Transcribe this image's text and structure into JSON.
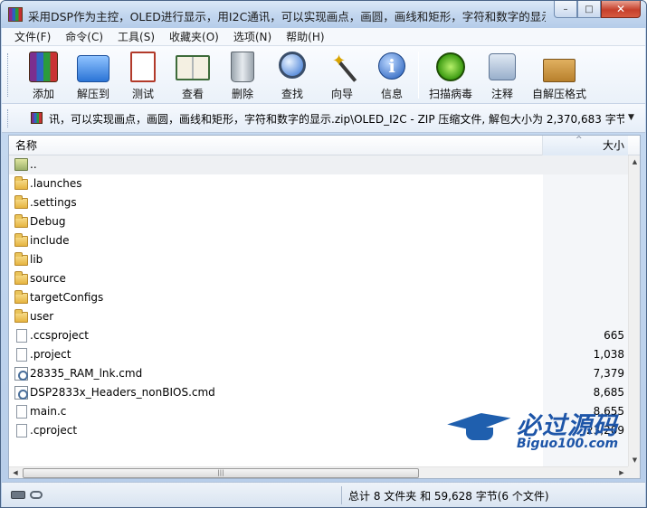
{
  "window": {
    "title": "采用DSP作为主控，OLED进行显示，用I2C通讯，可以实现画点，画圆，画线和矩形，字符和数字的显示...",
    "controls": {
      "minimize": "–",
      "maximize": "□",
      "close": "✕"
    }
  },
  "menu": [
    "文件(F)",
    "命令(C)",
    "工具(S)",
    "收藏夹(O)",
    "选项(N)",
    "帮助(H)"
  ],
  "toolbar": {
    "add": "添加",
    "extract_to": "解压到",
    "test": "测试",
    "view": "查看",
    "delete": "删除",
    "find": "查找",
    "wizard": "向导",
    "info": "信息",
    "virus_scan": "扫描病毒",
    "comment": "注释",
    "sfx": "自解压格式"
  },
  "address": {
    "path": "讯，可以实现画点，画圆，画线和矩形，字符和数字的显示.zip\\OLED_I2C - ZIP 压缩文件, 解包大小为 2,370,683 字节",
    "dropdown": "▼"
  },
  "columns": {
    "name": "名称",
    "size": "大小",
    "sort_arrow": "^"
  },
  "files": [
    {
      "name": "..",
      "size": "",
      "type": "up"
    },
    {
      "name": ".launches",
      "size": "",
      "type": "folder"
    },
    {
      "name": ".settings",
      "size": "",
      "type": "folder"
    },
    {
      "name": "Debug",
      "size": "",
      "type": "folder"
    },
    {
      "name": "include",
      "size": "",
      "type": "folder"
    },
    {
      "name": "lib",
      "size": "",
      "type": "folder"
    },
    {
      "name": "source",
      "size": "",
      "type": "folder"
    },
    {
      "name": "targetConfigs",
      "size": "",
      "type": "folder"
    },
    {
      "name": "user",
      "size": "",
      "type": "folder"
    },
    {
      "name": ".ccsproject",
      "size": "665",
      "type": "file"
    },
    {
      "name": ".project",
      "size": "1,038",
      "type": "file"
    },
    {
      "name": "28335_RAM_lnk.cmd",
      "size": "7,379",
      "type": "cmd"
    },
    {
      "name": "DSP2833x_Headers_nonBIOS.cmd",
      "size": "8,685",
      "type": "cmd"
    },
    {
      "name": "main.c",
      "size": "8,655",
      "type": "file"
    },
    {
      "name": ".cproject",
      "size": "23,209",
      "type": "file"
    }
  ],
  "statusbar": {
    "summary": "总计 8 文件夹 和 59,628 字节(6 个文件)"
  },
  "watermark": {
    "text": "必过源码",
    "url": "Biguo100.com"
  },
  "colors": {
    "accent": "#1d55a8",
    "title_bar": "#c3d7ef",
    "folder": "#e6b440"
  }
}
